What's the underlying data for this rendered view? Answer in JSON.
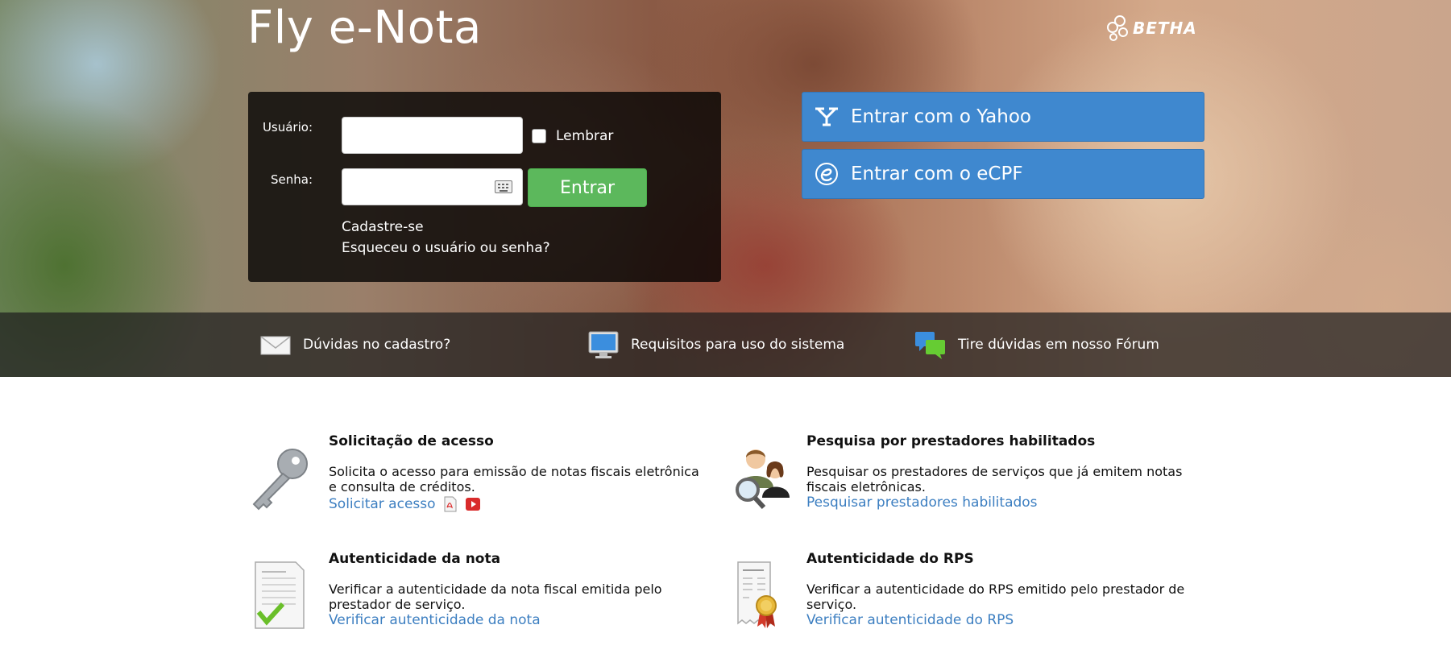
{
  "header": {
    "app_title": "Fly e-Nota",
    "brand_logo_text": "BETHA"
  },
  "login": {
    "user_label": "Usuário:",
    "user_value": "",
    "password_label": "Senha:",
    "password_value": "",
    "remember_label": "Lembrar",
    "remember_checked": false,
    "submit_label": "Entrar",
    "signup_link": "Cadastre-se",
    "forgot_link": "Esqueceu o usuário ou senha?"
  },
  "external_login": {
    "yahoo_label": "Entrar com o Yahoo",
    "ecpf_label": "Entrar com o eCPF"
  },
  "help_bar": {
    "items": [
      {
        "label": "Dúvidas no cadastro?",
        "icon": "envelope-icon"
      },
      {
        "label": "Requisitos para uso do sistema",
        "icon": "monitor-icon"
      },
      {
        "label": "Tire dúvidas em nosso Fórum",
        "icon": "chat-bubbles-icon"
      }
    ]
  },
  "features": [
    {
      "title": "Solicitação de acesso",
      "description": "Solicita o acesso para emissão de notas fiscais eletrônica e consulta de créditos.",
      "link": "Solicitar acesso",
      "icon": "key-icon"
    },
    {
      "title": "Pesquisa por prestadores habilitados",
      "description": "Pesquisar os prestadores de serviços que já emitem notas fiscais eletrônicas.",
      "link": "Pesquisar prestadores habilitados",
      "icon": "users-search-icon"
    },
    {
      "title": "Autenticidade da nota",
      "description": "Verificar a autenticidade da nota fiscal emitida pelo prestador de serviço.",
      "link": "Verificar autenticidade da nota",
      "icon": "invoice-check-icon"
    },
    {
      "title": "Autenticidade do RPS",
      "description": "Verificar a autenticidade do RPS emitido pelo prestador de serviço.",
      "link": "Verificar autenticidade do RPS",
      "icon": "receipt-seal-icon"
    }
  ],
  "colors": {
    "primary_blue": "#3f88cf",
    "login_green": "#5cb85c",
    "link_blue": "#3d7fc1"
  }
}
